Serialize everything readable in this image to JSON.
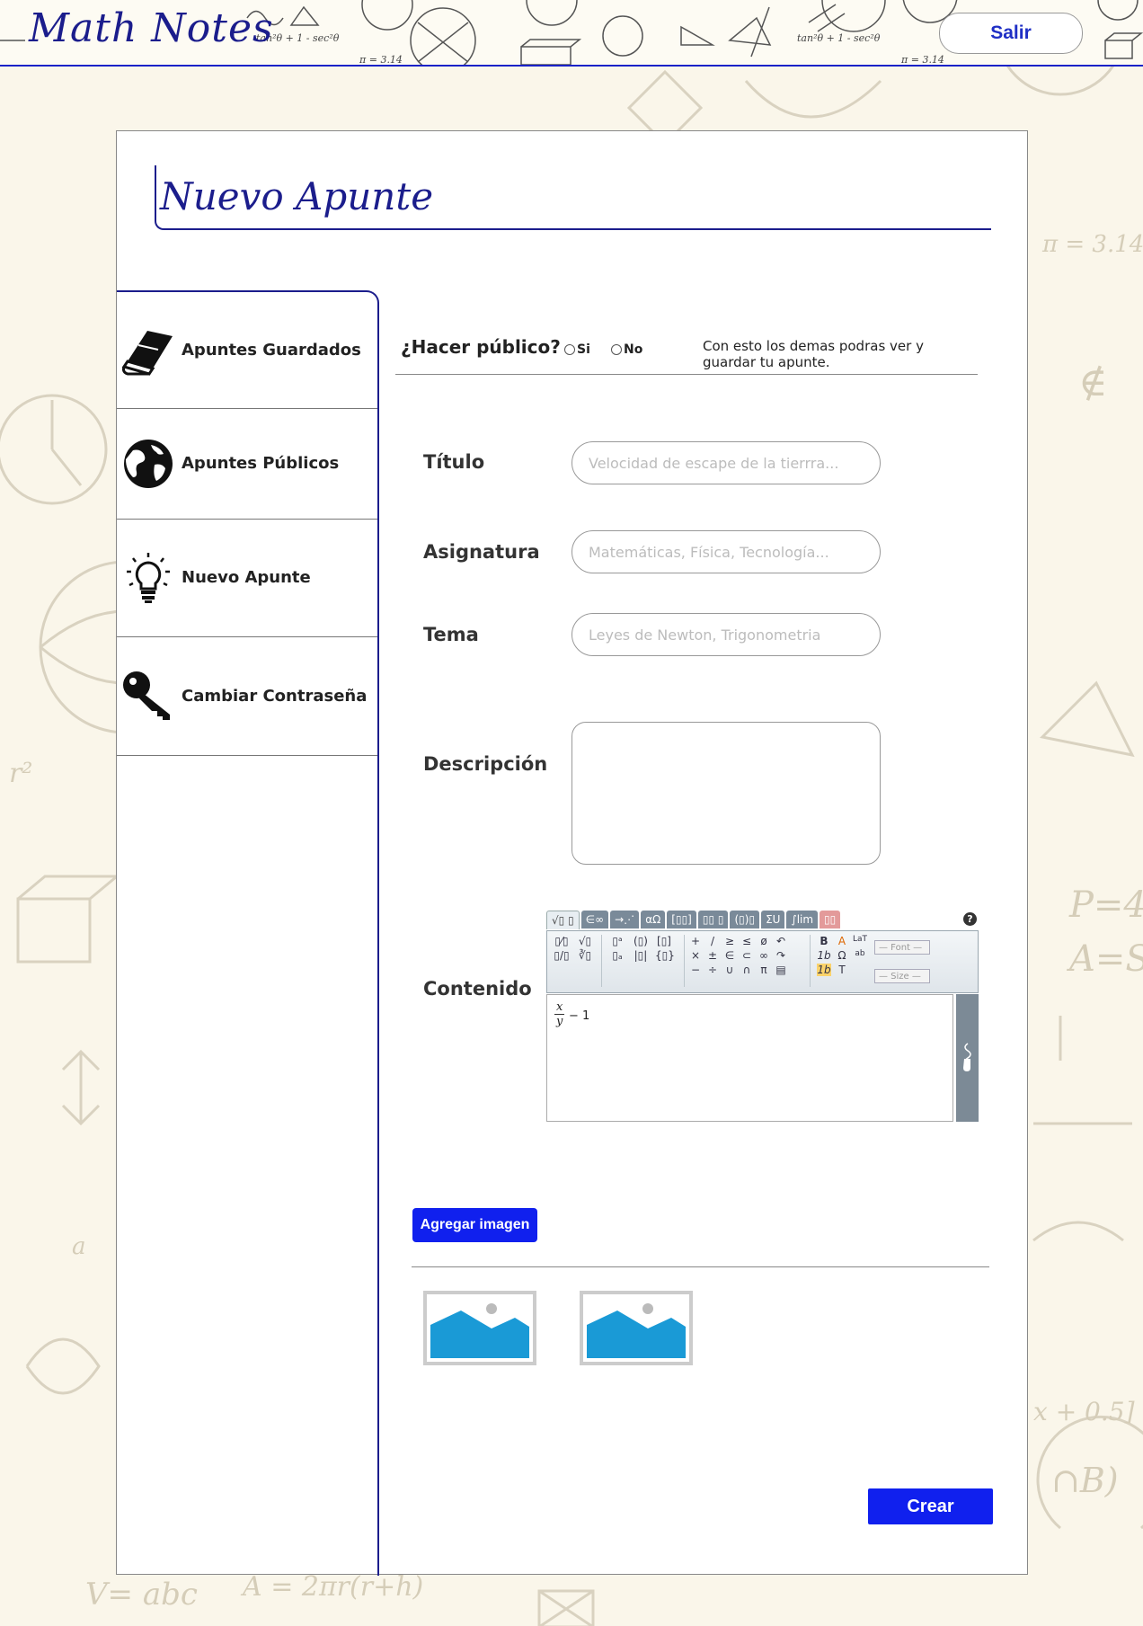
{
  "header": {
    "brand": "Math Notes",
    "logout_label": "Salir"
  },
  "page_title": "Nuevo Apunte",
  "sidebar": {
    "items": [
      {
        "label": "Apuntes Guardados",
        "icon": "book-icon"
      },
      {
        "label": "Apuntes Públicos",
        "icon": "globe-icon"
      },
      {
        "label": "Nuevo Apunte",
        "icon": "lightbulb-icon"
      },
      {
        "label": "Cambiar Contraseña",
        "icon": "key-icon"
      }
    ]
  },
  "form": {
    "public_question": "¿Hacer público?",
    "public_yes": "Si",
    "public_no": "No",
    "public_note": "Con esto los demas podras ver y guardar  tu apunte.",
    "title_label": "Título",
    "title_placeholder": "Velocidad de escape de la tierrra...",
    "subject_label": "Asignatura",
    "subject_placeholder": "Matemáticas, Física, Tecnología...",
    "topic_label": "Tema",
    "topic_placeholder": "Leyes de Newton, Trigonometria",
    "description_label": "Descripción",
    "content_label": "Contenido",
    "content_formula": {
      "numerator": "x",
      "denominator": "y",
      "rest": "− 1"
    },
    "add_image_label": "Agregar imagen",
    "create_label": "Crear"
  },
  "editor": {
    "tabs": [
      "√▯ ▯",
      "∈∞",
      "→⋰",
      "αΩ",
      "[▯▯]",
      "▯▯ ▯",
      "(▯)▯",
      "ΣU",
      "∫lim",
      "▯▯"
    ],
    "font_select": "— Font —",
    "size_select": "— Size —"
  },
  "colors": {
    "brand": "#1b1d8c",
    "accent": "#1020ee",
    "background": "#faf6ea"
  }
}
